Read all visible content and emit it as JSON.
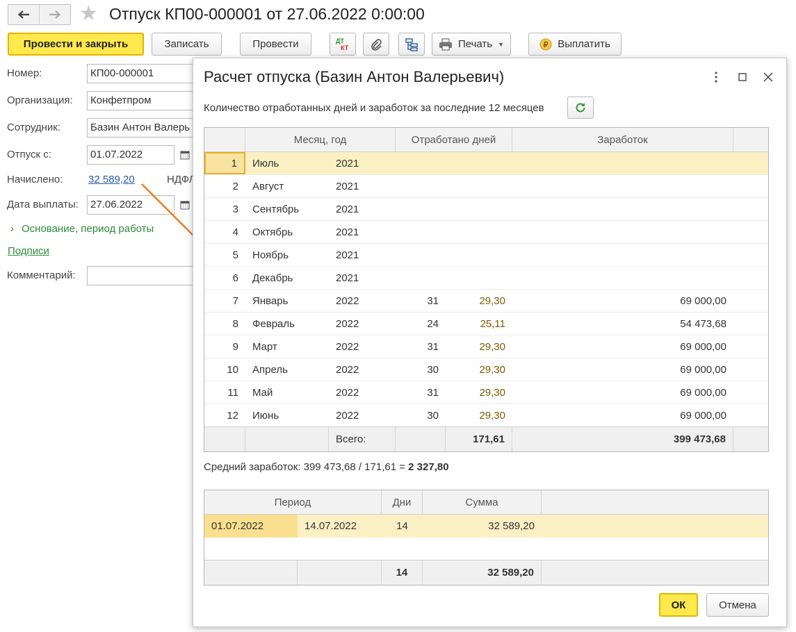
{
  "window": {
    "title": "Отпуск КП00-000001 от 27.06.2022 0:00:00"
  },
  "toolbar": {
    "post_close": "Провести и закрыть",
    "save": "Записать",
    "post": "Провести",
    "dtkt_top": "ДТ",
    "dtkt_bottom": "КТ",
    "print": "Печать",
    "pay": "Выплатить"
  },
  "form": {
    "number_label": "Номер:",
    "number_value": "КП00-000001",
    "org_label": "Организация:",
    "org_value": "Конфетпром",
    "employee_label": "Сотрудник:",
    "employee_value": "Базин Антон Валерь",
    "vacation_from_label": "Отпуск с:",
    "vacation_from_value": "01.07.2022",
    "accrued_label": "Начислено:",
    "accrued_value": "32 589,20",
    "ndfl_label": "НДФЛ",
    "payment_date_label": "Дата выплаты:",
    "payment_date_value": "27.06.2022",
    "basis_label": "Основание, период работы",
    "signatures_label": "Подписи",
    "comment_label": "Комментарий:"
  },
  "dialog": {
    "title": "Расчет отпуска (Базин Антон Валерьевич)",
    "subtitle": "Количество отработанных дней и заработок за последние 12 месяцев",
    "earnings_table": {
      "headers": {
        "month_year": "Месяц, год",
        "days_worked": "Отработано дней",
        "earnings": "Заработок"
      },
      "rows": [
        {
          "n": "1",
          "month": "Июль",
          "year": "2021",
          "days": "",
          "coef": "",
          "earnings": ""
        },
        {
          "n": "2",
          "month": "Август",
          "year": "2021",
          "days": "",
          "coef": "",
          "earnings": ""
        },
        {
          "n": "3",
          "month": "Сентябрь",
          "year": "2021",
          "days": "",
          "coef": "",
          "earnings": ""
        },
        {
          "n": "4",
          "month": "Октябрь",
          "year": "2021",
          "days": "",
          "coef": "",
          "earnings": ""
        },
        {
          "n": "5",
          "month": "Ноябрь",
          "year": "2021",
          "days": "",
          "coef": "",
          "earnings": ""
        },
        {
          "n": "6",
          "month": "Декабрь",
          "year": "2021",
          "days": "",
          "coef": "",
          "earnings": ""
        },
        {
          "n": "7",
          "month": "Январь",
          "year": "2022",
          "days": "31",
          "coef": "29,30",
          "earnings": "69 000,00"
        },
        {
          "n": "8",
          "month": "Февраль",
          "year": "2022",
          "days": "24",
          "coef": "25,11",
          "earnings": "54 473,68"
        },
        {
          "n": "9",
          "month": "Март",
          "year": "2022",
          "days": "31",
          "coef": "29,30",
          "earnings": "69 000,00"
        },
        {
          "n": "10",
          "month": "Апрель",
          "year": "2022",
          "days": "30",
          "coef": "29,30",
          "earnings": "69 000,00"
        },
        {
          "n": "11",
          "month": "Май",
          "year": "2022",
          "days": "31",
          "coef": "29,30",
          "earnings": "69 000,00"
        },
        {
          "n": "12",
          "month": "Июнь",
          "year": "2022",
          "days": "30",
          "coef": "29,30",
          "earnings": "69 000,00"
        }
      ],
      "total_label": "Всего:",
      "total_days": "171,61",
      "total_earnings": "399 473,68"
    },
    "average_prefix": "Средний заработок: 399 473,68 / 171,61 = ",
    "average_value": "2 327,80",
    "period_table": {
      "headers": {
        "period": "Период",
        "days": "Дни",
        "sum": "Сумма"
      },
      "rows": [
        {
          "from": "01.07.2022",
          "to": "14.07.2022",
          "days": "14",
          "sum": "32 589,20"
        }
      ],
      "total_days": "14",
      "total_sum": "32 589,20"
    },
    "ok_label": "ОК",
    "cancel_label": "Отмена"
  },
  "colors": {
    "primary_button": "#ffe94c",
    "selection": "#fbefc4",
    "link": "#2a59a8",
    "green_link": "#2e8b3c",
    "arrow": "#f07a1f"
  }
}
